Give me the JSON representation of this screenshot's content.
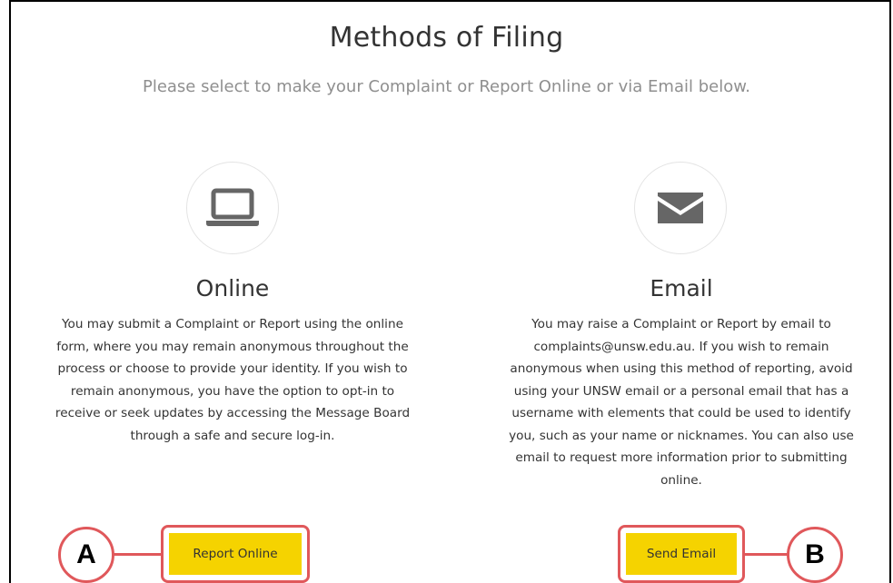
{
  "header": {
    "title": "Methods of Filing",
    "subtitle": "Please select to make your Complaint or Report Online or via Email below."
  },
  "online": {
    "icon": "laptop-icon",
    "title": "Online",
    "lines": [
      "You may submit a Complaint or Report using the online",
      "form, where you may remain anonymous throughout the",
      "process or choose to provide your identity. If you wish to",
      "remain anonymous, you have the option to opt-in to",
      "receive or seek updates by accessing the Message Board",
      "through a safe and secure log-in."
    ],
    "button_label": "Report Online",
    "callout": "A"
  },
  "email": {
    "icon": "envelope-icon",
    "title": "Email",
    "lines": [
      "You may raise a Complaint or Report by email to",
      "complaints@unsw.edu.au. If you wish to remain",
      "anonymous when using this method of reporting, avoid",
      "using your UNSW email or a personal email that has a",
      "username with elements that could be used to identify",
      "you, such as your name or nicknames. You can also use",
      "email to request more information prior to submitting",
      "online."
    ],
    "button_label": "Send Email",
    "callout": "B"
  },
  "colors": {
    "button": "#f5d300",
    "callout": "#e0585b",
    "icon": "#666666"
  }
}
